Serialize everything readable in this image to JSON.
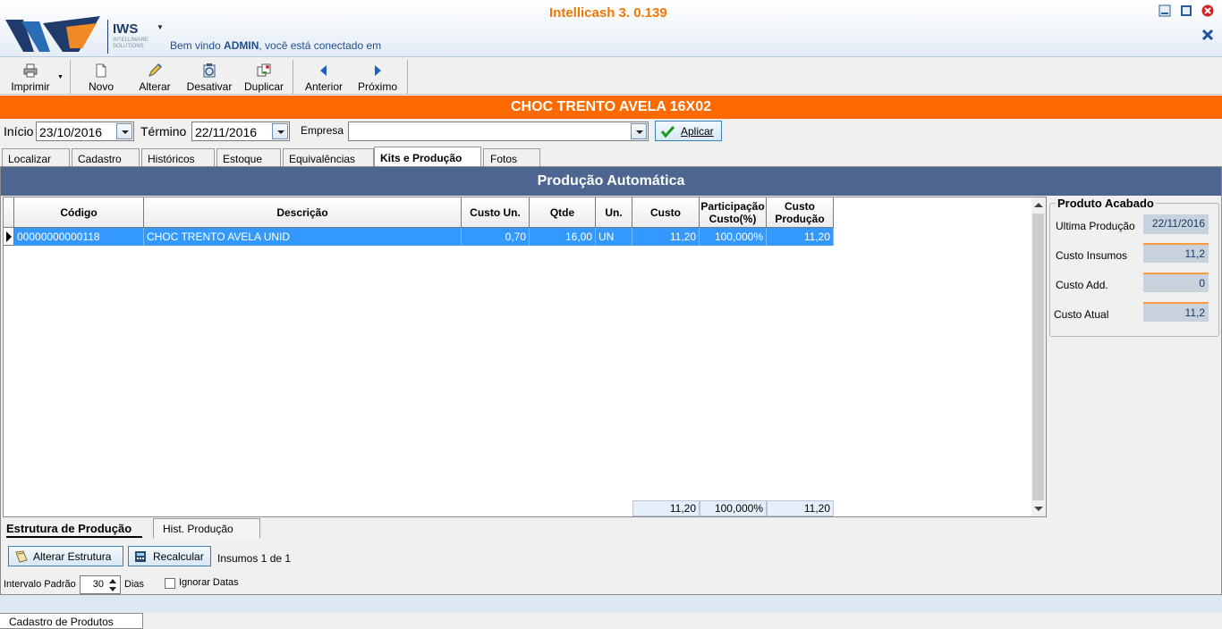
{
  "app": {
    "title": "Intellicash 3. 0.139",
    "logo_text": "IWS",
    "logo_sub": "INTELLIWARE SOLUTIONS",
    "welcome_prefix": "Bem vindo",
    "user": "ADMIN",
    "welcome_suffix": ", você está conectado em"
  },
  "toolbar": {
    "imprimir": "Imprimir",
    "novo": "Novo",
    "alterar": "Alterar",
    "desativar": "Desativar",
    "duplicar": "Duplicar",
    "anterior": "Anterior",
    "proximo": "Próximo"
  },
  "product": {
    "name": "CHOC TRENTO AVELA 16X02"
  },
  "filter": {
    "inicio_label": "Início",
    "inicio_value": "23/10/2016",
    "termino_label": "Término",
    "termino_value": "22/11/2016",
    "empresa_label": "Empresa",
    "empresa_value": "",
    "aplicar": "Aplicar"
  },
  "tabs": [
    "Localizar",
    "Cadastro",
    "Históricos",
    "Estoque",
    "Equivalências",
    "Kits e Produção",
    "Fotos"
  ],
  "section_title": "Produção Automática",
  "grid": {
    "headers": [
      "Código",
      "Descrição",
      "Custo Un.",
      "Qtde",
      "Un.",
      "Custo",
      "Participação Custo(%)",
      "Custo Produção"
    ],
    "rows": [
      [
        "00000000000118",
        "CHOC TRENTO AVELA UNID",
        "0,70",
        "16,00",
        "UN",
        "11,20",
        "100,000%",
        "11,20"
      ]
    ],
    "totals": {
      "custo": "11,20",
      "participacao": "100,000%",
      "custo_producao": "11,20"
    }
  },
  "produto_acabado": {
    "title": "Produto Acabado",
    "ultima_producao_label": "Ultima Produção",
    "ultima_producao": "22/11/2016",
    "custo_insumos_label": "Custo Insumos",
    "custo_insumos": "11,2",
    "custo_add_label": "Custo Add.",
    "custo_add": "0",
    "custo_atual_label": "Custo Atual",
    "custo_atual": "11,2"
  },
  "subtabs": [
    "Estrutura de Produção",
    "Hist. Produção"
  ],
  "actions": {
    "alterar_estrutura": "Alterar Estrutura",
    "recalcular": "Recalcular",
    "insumos_count": "Insumos 1 de 1",
    "intervalo_label": "Intervalo Padrão",
    "intervalo_value": "30",
    "dias_label": "Dias",
    "ignorar_datas": "Ignorar Datas"
  },
  "bottom_tab": "Cadastro de Produtos",
  "colors": {
    "orange": "#ff6a00",
    "section": "#4c6591",
    "selection": "#3399ff",
    "title": "#f07800"
  }
}
